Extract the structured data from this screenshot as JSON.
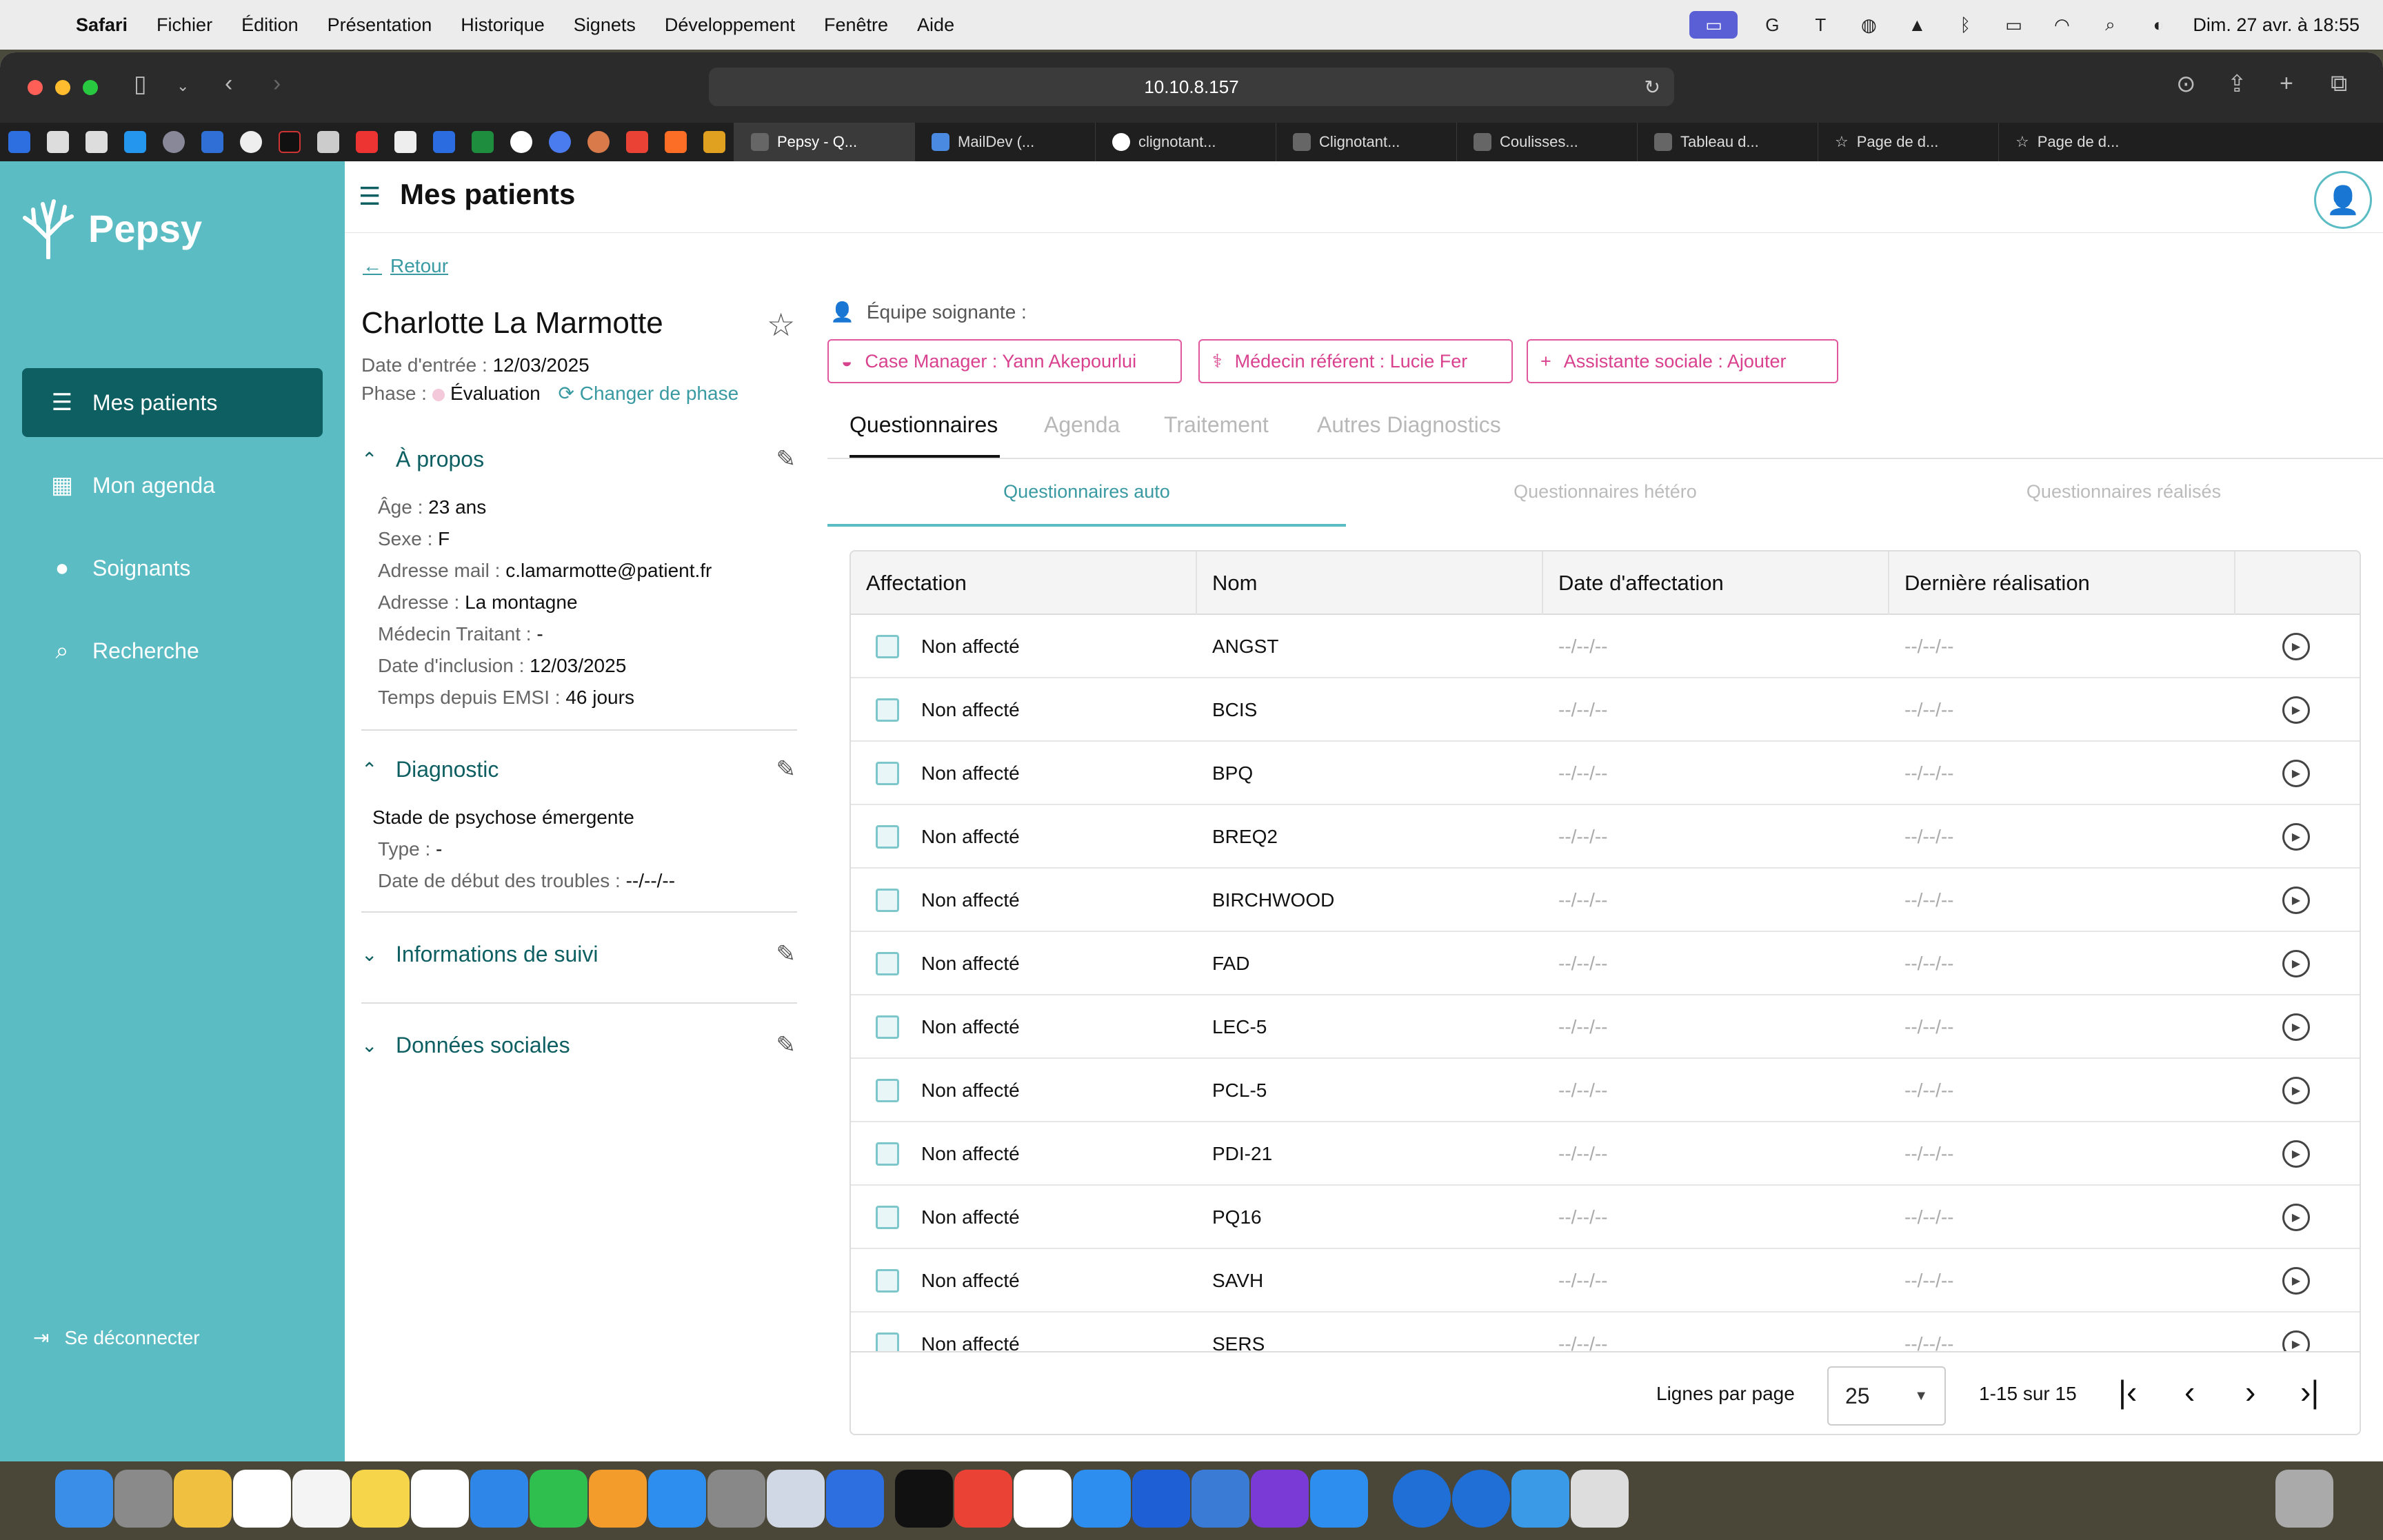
{
  "menubar": {
    "app": "Safari",
    "items": [
      "Fichier",
      "Édition",
      "Présentation",
      "Historique",
      "Signets",
      "Développement",
      "Fenêtre",
      "Aide"
    ],
    "clock": "Dim. 27 avr. à 18:55"
  },
  "browser": {
    "address": "10.10.8.157",
    "tabs": [
      {
        "label": "Pepsy - Q...",
        "active": true
      },
      {
        "label": "MailDev (...",
        "active": false
      },
      {
        "label": "clignotant...",
        "active": false
      },
      {
        "label": "Clignotant...",
        "active": false
      },
      {
        "label": "Coulisses...",
        "active": false
      },
      {
        "label": "Tableau d...",
        "active": false
      },
      {
        "label": "Page de d...",
        "active": false
      },
      {
        "label": "Page de d...",
        "active": false
      }
    ]
  },
  "app": {
    "logo": "Pepsy",
    "nav": [
      {
        "label": "Mes patients",
        "icon": "patients-list-icon",
        "active": true
      },
      {
        "label": "Mon agenda",
        "icon": "calendar-icon",
        "active": false
      },
      {
        "label": "Soignants",
        "icon": "caregiver-icon",
        "active": false
      },
      {
        "label": "Recherche",
        "icon": "search-book-icon",
        "active": false
      }
    ],
    "logout": "Se déconnecter",
    "page_title": "Mes patients"
  },
  "patient": {
    "back": "Retour",
    "name": "Charlotte La Marmotte",
    "entry_label": "Date d'entrée :",
    "entry_date": "12/03/2025",
    "phase_label": "Phase :",
    "phase": "Évaluation",
    "change_phase": "Changer de phase",
    "sections": {
      "about": {
        "title": "À propos",
        "fields": [
          {
            "label": "Âge :",
            "value": "23 ans"
          },
          {
            "label": "Sexe :",
            "value": "F"
          },
          {
            "label": "Adresse mail :",
            "value": "c.lamarmotte@patient.fr"
          },
          {
            "label": "Adresse :",
            "value": "La montagne"
          },
          {
            "label": "Médecin Traitant :",
            "value": "-"
          },
          {
            "label": "Date d'inclusion :",
            "value": "12/03/2025"
          },
          {
            "label": "Temps depuis EMSI :",
            "value": "46 jours"
          }
        ]
      },
      "diagnostic": {
        "title": "Diagnostic",
        "stage": "Stade de psychose émergente",
        "fields": [
          {
            "label": "Type :",
            "value": "-"
          },
          {
            "label": "Date de début des troubles :",
            "value": "--/--/--"
          }
        ]
      },
      "followup": {
        "title": "Informations de suivi"
      },
      "social": {
        "title": "Données sociales"
      }
    }
  },
  "team": {
    "label": "Équipe soignante :",
    "chips": [
      "Case Manager : Yann Akepourlui",
      "Médecin référent : Lucie Fer",
      "Assistante sociale : Ajouter"
    ]
  },
  "tabs": [
    "Questionnaires",
    "Agenda",
    "Traitement",
    "Autres Diagnostics"
  ],
  "subtabs": [
    "Questionnaires auto",
    "Questionnaires hétéro",
    "Questionnaires réalisés"
  ],
  "table": {
    "columns": [
      "Affectation",
      "Nom",
      "Date d'affectation",
      "Dernière réalisation"
    ],
    "rows": [
      {
        "status": "Non affecté",
        "name": "ANGST",
        "assigned": "--/--/--",
        "last": "--/--/--"
      },
      {
        "status": "Non affecté",
        "name": "BCIS",
        "assigned": "--/--/--",
        "last": "--/--/--"
      },
      {
        "status": "Non affecté",
        "name": "BPQ",
        "assigned": "--/--/--",
        "last": "--/--/--"
      },
      {
        "status": "Non affecté",
        "name": "BREQ2",
        "assigned": "--/--/--",
        "last": "--/--/--"
      },
      {
        "status": "Non affecté",
        "name": "BIRCHWOOD",
        "assigned": "--/--/--",
        "last": "--/--/--"
      },
      {
        "status": "Non affecté",
        "name": "FAD",
        "assigned": "--/--/--",
        "last": "--/--/--"
      },
      {
        "status": "Non affecté",
        "name": "LEC-5",
        "assigned": "--/--/--",
        "last": "--/--/--"
      },
      {
        "status": "Non affecté",
        "name": "PCL-5",
        "assigned": "--/--/--",
        "last": "--/--/--"
      },
      {
        "status": "Non affecté",
        "name": "PDI-21",
        "assigned": "--/--/--",
        "last": "--/--/--"
      },
      {
        "status": "Non affecté",
        "name": "PQ16",
        "assigned": "--/--/--",
        "last": "--/--/--"
      },
      {
        "status": "Non affecté",
        "name": "SAVH",
        "assigned": "--/--/--",
        "last": "--/--/--"
      },
      {
        "status": "Non affecté",
        "name": "SERS",
        "assigned": "--/--/--",
        "last": "--/--/--"
      }
    ],
    "footer": {
      "rows_label": "Lignes par page",
      "rows_value": "25",
      "range": "1-15 sur 15"
    }
  },
  "colors": {
    "sidebar": "#5bbcc4",
    "nav_active": "#0e5f62",
    "accent": "#3a9aa2",
    "chip": "#e0579e"
  }
}
